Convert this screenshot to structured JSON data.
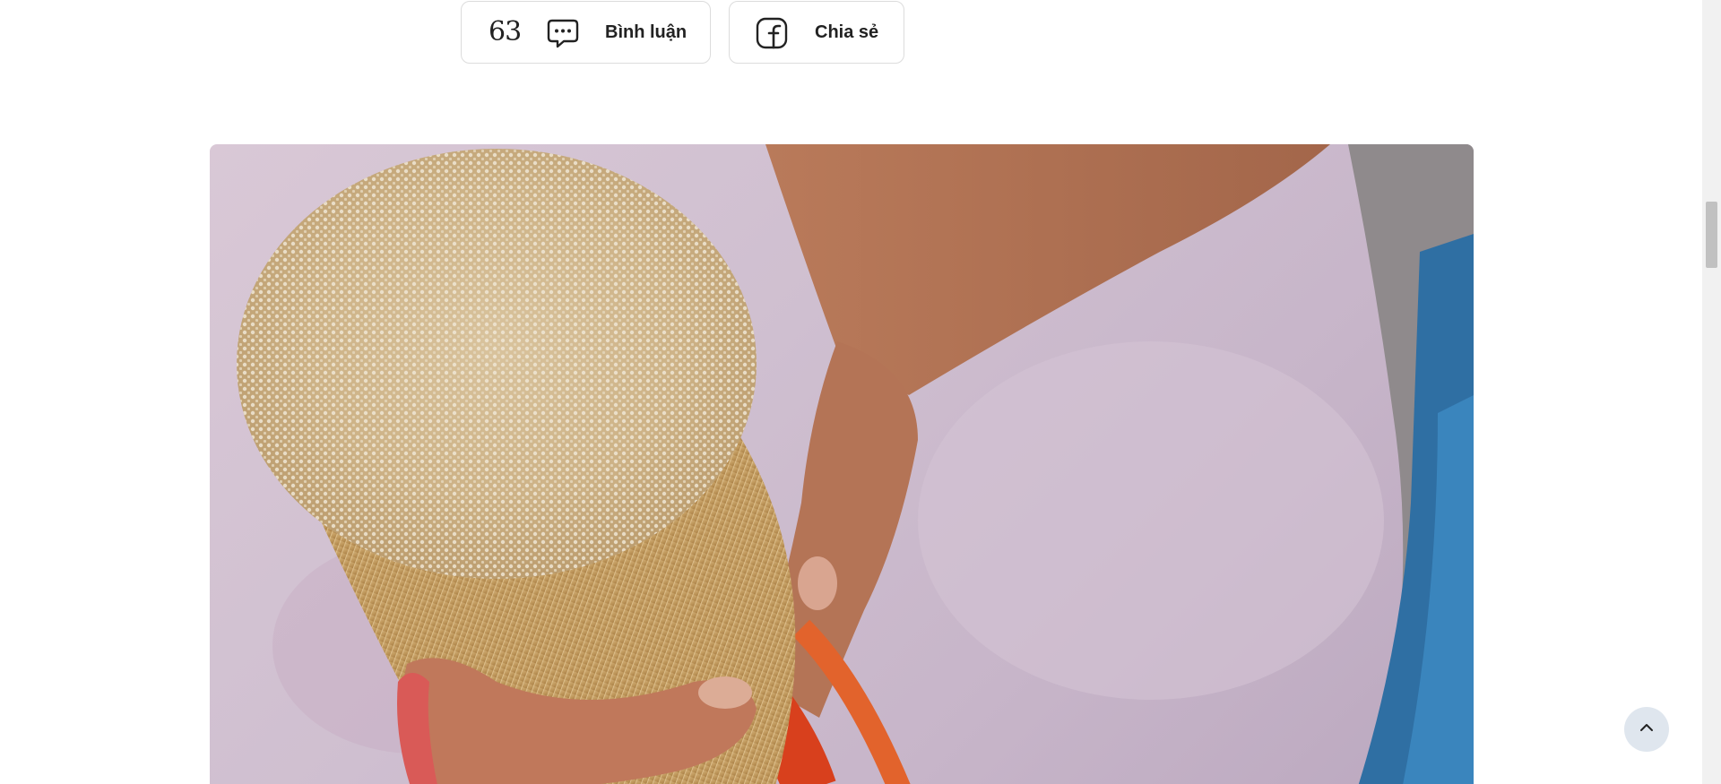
{
  "article_actions": {
    "comment_count": "63",
    "comment_label": "Bình luận",
    "share_label": "Chia sẻ"
  },
  "icons": {
    "comment": "speech-bubble-icon",
    "share": "facebook-icon",
    "back_to_top": "chevron-up-icon"
  },
  "colors": {
    "text": "#222222",
    "border": "#dcdcdc",
    "back_to_top_bg": "#dfe6ee"
  }
}
